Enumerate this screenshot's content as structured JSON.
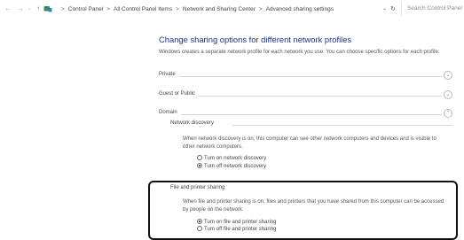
{
  "address_bar": {
    "nav_back": "←",
    "nav_forward": "→",
    "nav_history": "⌄",
    "nav_up": "↑",
    "breadcrumbs": [
      "Control Panel",
      "All Control Panel Items",
      "Network and Sharing Center",
      "Advanced sharing settings"
    ],
    "breadcrumb_separator": ">",
    "dropdown_glyph": "⌄",
    "refresh_glyph": "↻",
    "search_placeholder": "Search Control Panel"
  },
  "main": {
    "title": "Change sharing options for different network profiles",
    "description": "Windows creates a separate network profile for each network you use. You can choose specific options for each profile.",
    "profiles": [
      {
        "label": "Private",
        "expanded": false,
        "chevron": "⌄"
      },
      {
        "label": "Guest or Public",
        "expanded": false,
        "chevron": "⌄"
      },
      {
        "label": "Domain",
        "expanded": true,
        "chevron": "⌃"
      }
    ],
    "network_discovery": {
      "label": "Network discovery",
      "description": "When network discovery is on, this computer can see other network computers and devices and is visible to other network computers.",
      "options": [
        {
          "label": "Turn on network discovery",
          "selected": false
        },
        {
          "label": "Turn off network discovery",
          "selected": true
        }
      ]
    },
    "file_printer_sharing": {
      "label": "File and printer sharing",
      "description": "When file and printer sharing is on, files and printers that you have shared from this computer can be accessed by people on the network.",
      "options": [
        {
          "label": "Turn on file and printer sharing",
          "selected": true
        },
        {
          "label": "Turn off file and printer sharing",
          "selected": false
        }
      ]
    }
  },
  "colors": {
    "title": "#1e3287",
    "highlight_box": "#111111",
    "divider": "#d6d6d6"
  }
}
